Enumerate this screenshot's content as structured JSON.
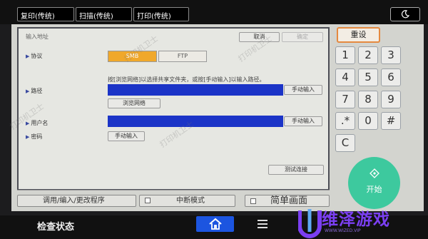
{
  "top_tabs": [
    {
      "label": "复印(传统)"
    },
    {
      "label": "扫描(传统)"
    },
    {
      "label": "打印(传统)"
    }
  ],
  "panel": {
    "title": "输入地址",
    "cancel": "取消",
    "ok": "确定",
    "protocol_label": "协议",
    "protocol_options": [
      "SMB",
      "FTP"
    ],
    "protocol_selected": "SMB",
    "hint": "按[浏览网络]以选择共享文件夹，或按[手动输入]以输入路径。",
    "path_label": "路径",
    "path_value": "",
    "manual_input": "手动输入",
    "browse_network": "浏览网络",
    "username_label": "用户名",
    "username_value": "",
    "password_label": "密码",
    "test_connection": "测试连接"
  },
  "bottom_buttons": {
    "program": "调用/编入/更改程序",
    "interrupt": "中断模式",
    "simple": "简单画面"
  },
  "keypad": {
    "reset": "重设",
    "keys": [
      "1",
      "2",
      "3",
      "4",
      "5",
      "6",
      "7",
      "8",
      "9",
      ".*",
      "0",
      "#",
      "C"
    ],
    "start": "开始"
  },
  "status_bar": {
    "check_status": "检查状态"
  },
  "watermark": {
    "text": "打印机卫士",
    "logo_name": "维泽游戏",
    "logo_sub": "WWW.WIZED.VIP"
  },
  "colors": {
    "selected_option": "#f0a82b",
    "input_fill": "#1b34c7",
    "start_button": "#3dc99e",
    "home_button": "#1c55e0",
    "reset_border": "#e5893f",
    "logo": "#7b3ff2"
  }
}
